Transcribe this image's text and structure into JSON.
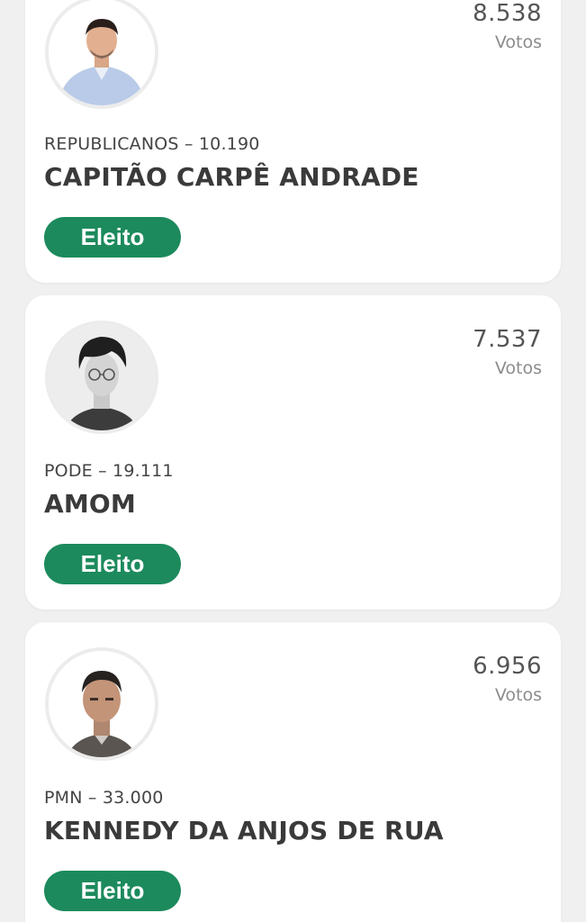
{
  "candidates": [
    {
      "votes": "8.538",
      "votes_label": "Votos",
      "party": "REPUBLICANOS – 10.190",
      "name": "CAPITÃO CARPÊ ANDRADE",
      "status": "Eleito",
      "photo": "candidate-photo"
    },
    {
      "votes": "7.537",
      "votes_label": "Votos",
      "party": "PODE – 19.111",
      "name": "AMOM",
      "status": "Eleito",
      "photo": "candidate-photo"
    },
    {
      "votes": "6.956",
      "votes_label": "Votos",
      "party": "PMN – 33.000",
      "name": "KENNEDY DA ANJOS DE RUA",
      "status": "Eleito",
      "photo": "candidate-photo"
    }
  ],
  "colors": {
    "badge": "#1c8a5c",
    "background": "#f0f0f0",
    "card": "#ffffff"
  }
}
